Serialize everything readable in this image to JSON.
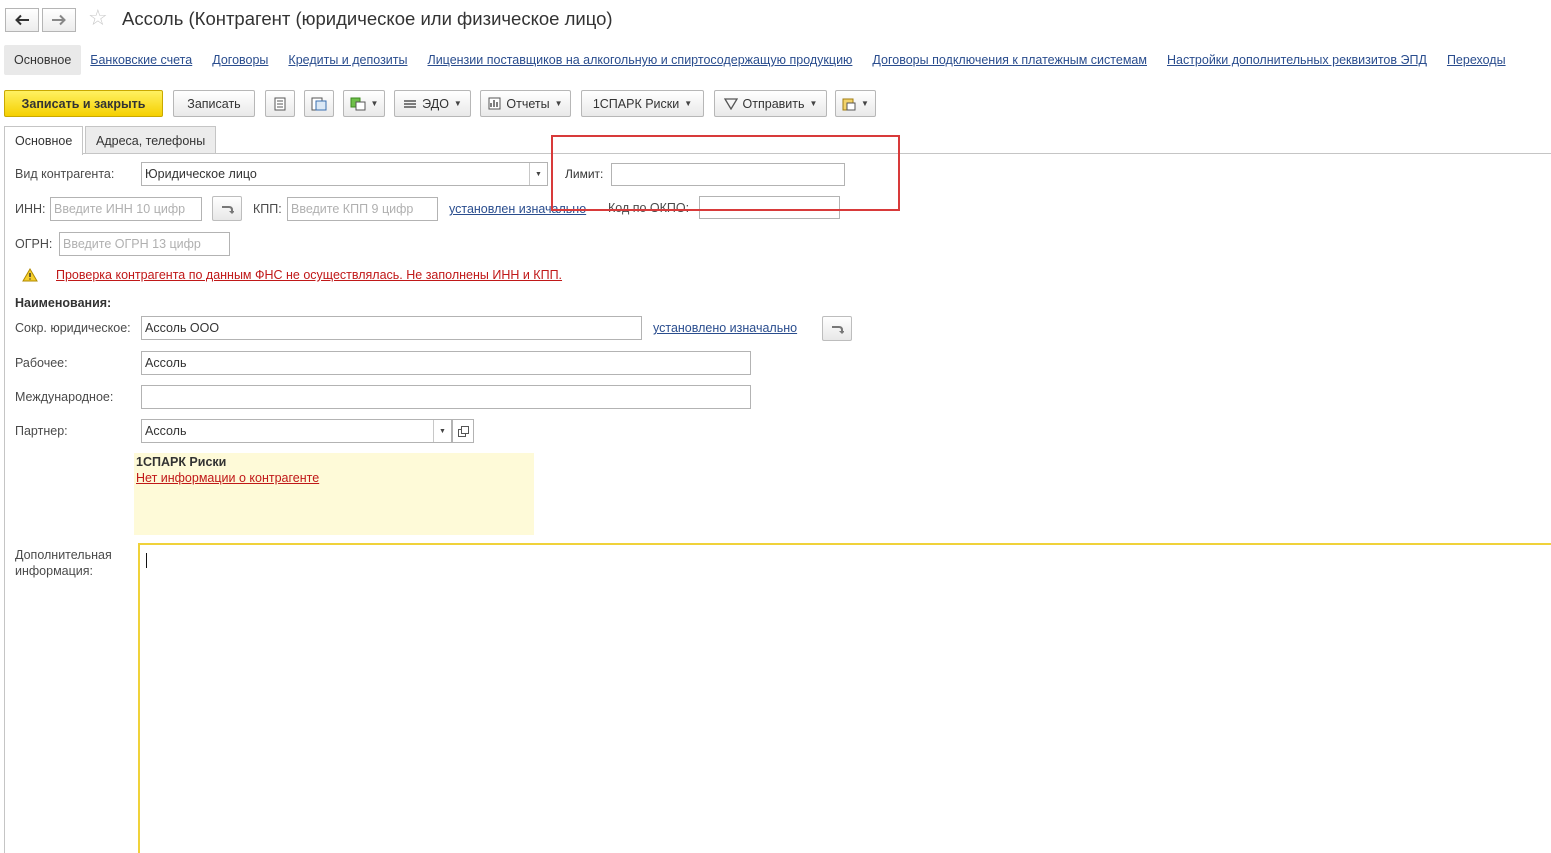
{
  "window": {
    "title": "Ассоль (Контрагент (юридическое или физическое лицо)",
    "back_icon": "arrow-left-icon",
    "forward_icon": "arrow-right-icon",
    "favorite_icon": "star-icon"
  },
  "nav_links": [
    "Основное",
    "Банковские счета",
    "Договоры",
    "Кредиты и депозиты",
    "Лицензии поставщиков на алкогольную и спиртосодержащую продукцию",
    "Договоры подключения к платежным системам",
    "Настройки дополнительных реквизитов ЭПД",
    "Переходы"
  ],
  "toolbar": {
    "save_close": "Записать и закрыть",
    "save": "Записать",
    "edo": "ЭДО",
    "reports": "Отчеты",
    "spark": "1СПАРК Риски",
    "send": "Отправить"
  },
  "tabs": [
    "Основное",
    "Адреса, телефоны"
  ],
  "form": {
    "kind_label": "Вид контрагента:",
    "kind_value": "Юридическое лицо",
    "limit_label": "Лимит:",
    "limit_value": "",
    "inn_label": "ИНН:",
    "inn_placeholder": "Введите ИНН 10 цифр",
    "kpp_label": "КПП:",
    "kpp_placeholder": "Введите КПП 9 цифр",
    "kpp_link": "установлен изначально",
    "okpo_label": "Код по ОКПО:",
    "okpo_value": "",
    "ogrn_label": "ОГРН:",
    "ogrn_placeholder": "Введите ОГРН 13 цифр",
    "warning": "Проверка контрагента по данным ФНС не осуществлялась. Не заполнены ИНН и КПП.",
    "names_header": "Наименования:",
    "short_label": "Сокр. юридическое:",
    "short_value": "Ассоль ООО",
    "short_link": "установлено изначально",
    "work_label": "Рабочее:",
    "work_value": "Ассоль",
    "intl_label": "Международное:",
    "intl_value": "",
    "partner_label": "Партнер:",
    "partner_value": "Ассоль",
    "spark_title": "1СПАРК Риски",
    "spark_link": "Нет информации о контрагенте",
    "extra_label": "Дополнительная информация:",
    "extra_value": ""
  },
  "colors": {
    "primary_button": "#f5d000",
    "link": "#2a4d8e",
    "warning_text": "#c01818",
    "highlight_box": "#d83a3a",
    "active_textarea": "#f0d23a",
    "spark_panel": "#fefad8"
  }
}
